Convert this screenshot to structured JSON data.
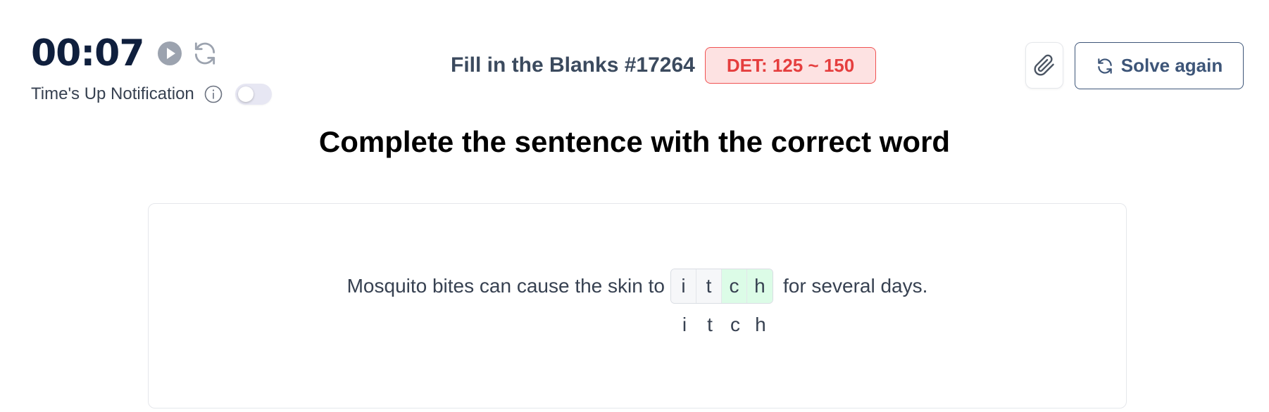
{
  "timer": {
    "time": "00:07",
    "play_icon": "play-icon",
    "reset_icon": "refresh-icon"
  },
  "notification": {
    "label": "Time's Up Notification",
    "info_icon": "info-icon",
    "enabled": false
  },
  "header": {
    "title": "Fill in the Blanks #17264",
    "det_badge": "DET: 125 ~ 150",
    "attach_icon": "paperclip-icon",
    "solve_again_label": "Solve again",
    "solve_again_icon": "refresh-icon"
  },
  "question": {
    "instruction": "Complete the sentence with the correct word",
    "before": "Mosquito bites can cause the skin to",
    "after": "for several days.",
    "blank_letters": [
      {
        "char": "i",
        "state": "given"
      },
      {
        "char": "t",
        "state": "given"
      },
      {
        "char": "c",
        "state": "filled"
      },
      {
        "char": "h",
        "state": "filled"
      }
    ],
    "answer_letters": [
      "i",
      "t",
      "c",
      "h"
    ]
  },
  "colors": {
    "timer_text": "#0f1f3d",
    "badge_bg": "#fde2e2",
    "badge_text": "#e53e3e",
    "solve_border": "#3d5578",
    "filled_cell": "#dcfce7"
  }
}
